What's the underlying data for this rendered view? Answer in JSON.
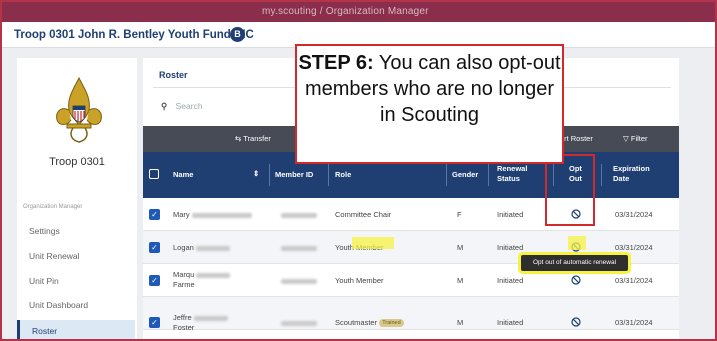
{
  "topbar": {
    "text": "my.scouting / Organization Manager"
  },
  "unit": {
    "title": "Troop 0301 John R. Bentley Youth Fund INC",
    "badge": "B"
  },
  "sidebar": {
    "troop_label": "Troop 0301",
    "section_label": "Organization Manager",
    "items": [
      {
        "label": "Settings"
      },
      {
        "label": "Unit Renewal"
      },
      {
        "label": "Unit Pin"
      },
      {
        "label": "Unit Dashboard"
      },
      {
        "label": "Roster"
      }
    ]
  },
  "main": {
    "tab": "Roster",
    "search_placeholder": "Search",
    "toolbar": {
      "transfer": "Transfer",
      "export": "Export Roster",
      "filter": "Filter"
    },
    "columns": {
      "name": "Name",
      "member_id": "Member ID",
      "role": "Role",
      "gender": "Gender",
      "renewal_status_1": "Renewal",
      "renewal_status_2": "Status",
      "opt_out_1": "Opt",
      "opt_out_2": "Out",
      "expiration_1": "Expiration",
      "expiration_2": "Date"
    },
    "rows": [
      {
        "first": "Mary",
        "last": "",
        "role": "Committee Chair",
        "badge": "",
        "gender": "F",
        "status": "Initiated",
        "expiration": "03/31/2024"
      },
      {
        "first": "Logan",
        "last": "",
        "role": "Youth Member",
        "badge": "",
        "gender": "M",
        "status": "Initiated",
        "expiration": "03/31/2024"
      },
      {
        "first": "Marqu",
        "last": "Farme",
        "role": "Youth Member",
        "badge": "",
        "gender": "M",
        "status": "Initiated",
        "expiration": "03/31/2024"
      },
      {
        "first": "Jeffre",
        "last": "Foster",
        "role": "Scoutmaster",
        "badge": "Trained",
        "gender": "M",
        "status": "Initiated",
        "expiration": "03/31/2024"
      }
    ]
  },
  "tooltip": {
    "text": "Opt out of automatic renewal"
  },
  "callout": {
    "step": "STEP 6:",
    "text": "You can also opt-out members who are no longer in Scouting"
  },
  "colors": {
    "navy": "#1f3f72",
    "highlight": "#f5f242",
    "callout_border": "#d22a2a"
  },
  "icons": {
    "opt_out": "block-icon",
    "sort": "sort-arrows-icon",
    "filter": "filter-icon",
    "transfer": "transfer-icon",
    "search": "search-icon",
    "checkbox": "checkbox-icon"
  }
}
